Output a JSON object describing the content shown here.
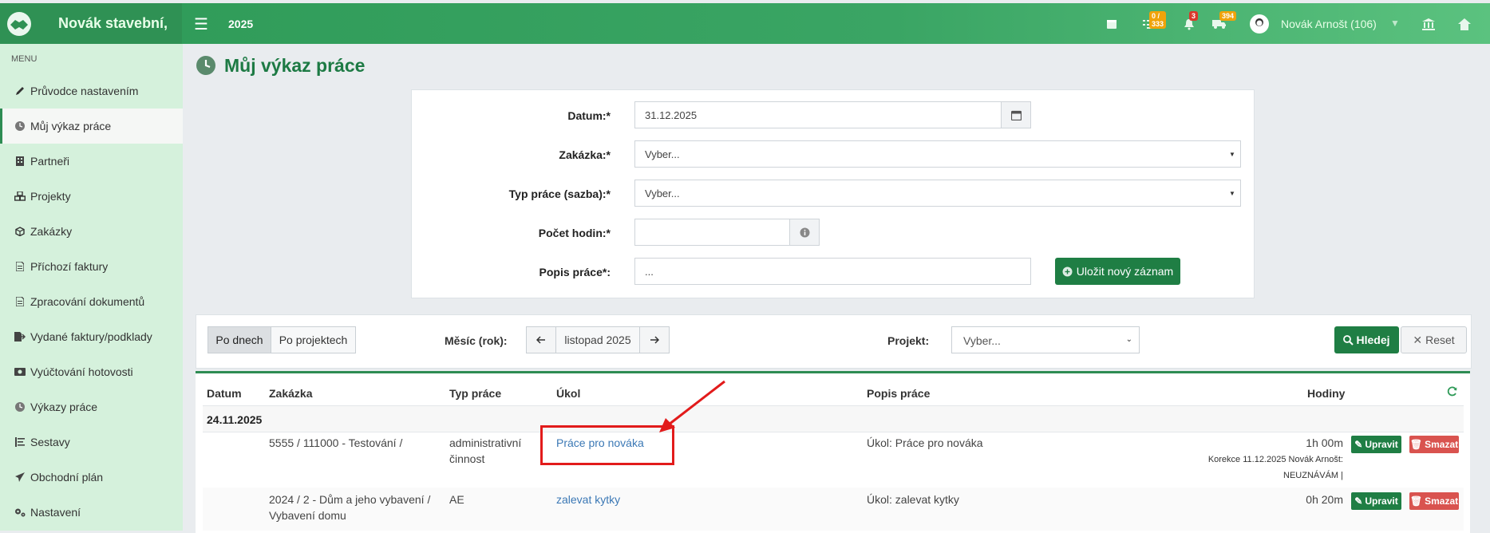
{
  "topbar": {
    "brand_name": "Novák stavební,",
    "year": "2025",
    "badges": {
      "tasks": "0 / 333",
      "notifications": "3",
      "shipments": "394"
    },
    "user_name": "Novák Arnošt (106)",
    "colors": {
      "bar": "#3aa564",
      "brand": "#2f9154"
    }
  },
  "sidebar": {
    "menu_title": "MENU",
    "items": [
      {
        "label": "Průvodce nastavením",
        "icon": "pencil-icon"
      },
      {
        "label": "Můj výkaz práce",
        "icon": "clock-icon",
        "active": true
      },
      {
        "label": "Partneři",
        "icon": "building-icon"
      },
      {
        "label": "Projekty",
        "icon": "cubes-icon"
      },
      {
        "label": "Zakázky",
        "icon": "cube-icon"
      },
      {
        "label": "Příchozí faktury",
        "icon": "file-icon"
      },
      {
        "label": "Zpracování dokumentů",
        "icon": "document-icon"
      },
      {
        "label": "Vydané faktury/podklady",
        "icon": "export-icon"
      },
      {
        "label": "Vyúčtování hotovosti",
        "icon": "money-icon"
      },
      {
        "label": "Výkazy práce",
        "icon": "clock-icon"
      },
      {
        "label": "Sestavy",
        "icon": "list-icon"
      },
      {
        "label": "Obchodní plán",
        "icon": "paper-plane-icon"
      },
      {
        "label": "Nastavení",
        "icon": "gears-icon"
      }
    ]
  },
  "page": {
    "title": "Můj výkaz práce"
  },
  "form": {
    "date_label": "Datum:*",
    "date_value": "31.12.2025",
    "order_label": "Zakázka:*",
    "order_value": "Vyber...",
    "worktype_label": "Typ práce (sazba):*",
    "worktype_value": "Vyber...",
    "hours_label": "Počet hodin:*",
    "hours_value": "",
    "desc_label": "Popis práce*:",
    "desc_placeholder": "...",
    "save_label": "Uložit nový záznam"
  },
  "filter": {
    "by_days": "Po dnech",
    "by_projects": "Po projektech",
    "month_label": "Měsíc (rok):",
    "month_value": "listopad 2025",
    "project_label": "Projekt:",
    "project_value": "Vyber...",
    "search_label": "Hledej",
    "reset_label": "Reset"
  },
  "table": {
    "headers": {
      "date": "Datum",
      "order": "Zakázka",
      "worktype": "Typ práce",
      "task": "Úkol",
      "desc": "Popis práce",
      "hours": "Hodiny"
    },
    "group_date": "24.11.2025",
    "rows": [
      {
        "order": "5555 / 111000 - Testování /",
        "worktype_line1": "administrativní",
        "worktype_line2": "činnost",
        "task": "Práce pro nováka",
        "desc": "Úkol: Práce pro nováka",
        "hours": "1h 00m",
        "note_line1": "Korekce 11.12.2025 Novák Arnošt:",
        "note_line2": "NEUZNÁVÁM |"
      },
      {
        "order_line1": "2024 / 2 - Dům a jeho vybavení /",
        "order_line2": "Vybavení domu",
        "worktype": "AE",
        "task": "zalevat kytky",
        "desc": "Úkol: zalevat kytky",
        "hours": "0h 20m"
      }
    ],
    "edit_label": "Upravit",
    "delete_label": "Smazat"
  }
}
